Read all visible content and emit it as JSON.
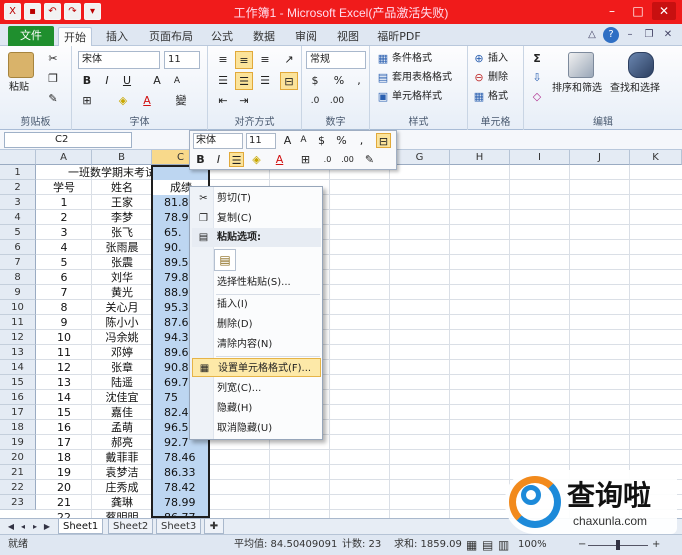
{
  "window": {
    "title": "工作簿1 - Microsoft Excel(产品激活失败)",
    "controls": [
      "–",
      "□",
      "✕"
    ]
  },
  "ribbon_tabs": {
    "file": "文件",
    "tabs": [
      "开始",
      "插入",
      "页面布局",
      "公式",
      "数据",
      "审阅",
      "视图",
      "福昕PDF"
    ]
  },
  "ribbon": {
    "clipboard": {
      "label": "剪贴板",
      "paste": "粘贴"
    },
    "font": {
      "label": "字体",
      "name": "宋体",
      "size": "11",
      "bold": "B",
      "italic": "I",
      "underline": "U",
      "grow": "A",
      "shrink": "A",
      "phonetic": "變"
    },
    "alignment": {
      "label": "对齐方式"
    },
    "number": {
      "label": "数字",
      "format": "常规",
      "percent": "%",
      "comma": ","
    },
    "styles": {
      "label": "样式",
      "conditional": "条件格式",
      "table": "套用表格格式",
      "cell": "单元格样式"
    },
    "cells": {
      "label": "单元格",
      "insert": "插入",
      "delete": "删除",
      "format": "格式"
    },
    "editing": {
      "label": "编辑",
      "sum": "Σ",
      "sort": "排序和筛选",
      "find": "查找和选择"
    }
  },
  "formula_bar": {
    "name_box": "C2"
  },
  "columns": [
    "A",
    "B",
    "C",
    "D",
    "E",
    "F",
    "G",
    "H",
    "I",
    "J",
    "K"
  ],
  "rows": [
    "1",
    "2",
    "3",
    "4",
    "5",
    "6",
    "7",
    "8",
    "9",
    "10",
    "11",
    "12",
    "13",
    "14",
    "15",
    "16",
    "17",
    "18",
    "19",
    "20",
    "21",
    "22",
    "23"
  ],
  "sheet": {
    "title": "一班数学期末考试成绩",
    "headers": [
      "学号",
      "姓名",
      "成绩"
    ],
    "records": [
      [
        "1",
        "王家",
        "81.8"
      ],
      [
        "2",
        "李梦",
        "78.9"
      ],
      [
        "3",
        "张飞",
        "65."
      ],
      [
        "4",
        "张雨晨",
        "90."
      ],
      [
        "5",
        "张震",
        "89.5"
      ],
      [
        "6",
        "刘华",
        "79.8"
      ],
      [
        "7",
        "黄光",
        "88.9"
      ],
      [
        "8",
        "关心月",
        "95.3"
      ],
      [
        "9",
        "陈小小",
        "87.6"
      ],
      [
        "10",
        "冯余姚",
        "94.3"
      ],
      [
        "11",
        "邓婷",
        "89.6"
      ],
      [
        "12",
        "张章",
        "90.8"
      ],
      [
        "13",
        "陆遥",
        "69.7"
      ],
      [
        "14",
        "沈佳宜",
        "75"
      ],
      [
        "15",
        "嘉佳",
        "82.4"
      ],
      [
        "16",
        "孟萌",
        "96.5"
      ],
      [
        "17",
        "郝亮",
        "92.7"
      ],
      [
        "18",
        "戴菲菲",
        "78.46"
      ],
      [
        "19",
        "袁梦洁",
        "86.33"
      ],
      [
        "20",
        "庄秀成",
        "78.42"
      ],
      [
        "21",
        "龚琳",
        "78.99"
      ],
      [
        "22",
        "蔡明明",
        "86.77"
      ]
    ]
  },
  "mini_toolbar": {
    "font": "宋体",
    "size": "11",
    "grow": "A",
    "shrink": "A",
    "percent": "%",
    "comma": ",",
    "bold": "B",
    "italic": "I"
  },
  "context_menu": {
    "cut": "剪切(T)",
    "copy": "复制(C)",
    "paste_options": "粘贴选项:",
    "paste_special": "选择性粘贴(S)...",
    "insert": "插入(I)",
    "delete": "删除(D)",
    "clear": "清除内容(N)",
    "format_cells": "设置单元格格式(F)...",
    "column_width": "列宽(C)...",
    "hide": "隐藏(H)",
    "unhide": "取消隐藏(U)"
  },
  "sheet_tabs": [
    "Sheet1",
    "Sheet2",
    "Sheet3"
  ],
  "status": {
    "ready": "就绪",
    "average": "平均值: 84.50409091",
    "count": "计数: 23",
    "sum": "求和: 1859.09",
    "zoom": "100%"
  },
  "watermark": {
    "brand": "查询啦",
    "domain": "chaxunla.com"
  },
  "colors": {
    "title_bar": "#f01b1b",
    "file_tab": "#1f8f2e",
    "selection": "#bdd6f1",
    "menu_hot": "#fde9a8"
  }
}
